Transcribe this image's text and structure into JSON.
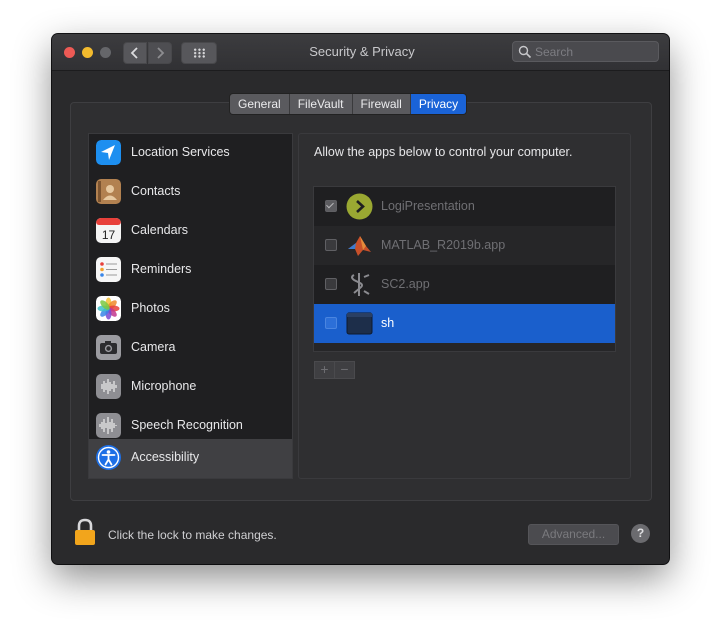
{
  "window": {
    "title": "Security & Privacy",
    "search_placeholder": "Search"
  },
  "icons": {
    "back": "chevron-left-icon",
    "forward": "chevron-right-icon",
    "grid": "grid-icon",
    "search": "search-icon",
    "lock": "lock-icon",
    "help": "question-mark-icon"
  },
  "tabs": [
    {
      "label": "General",
      "active": false
    },
    {
      "label": "FileVault",
      "active": false
    },
    {
      "label": "Firewall",
      "active": false
    },
    {
      "label": "Privacy",
      "active": true
    }
  ],
  "sidebar": {
    "items": [
      {
        "label": "Location Services",
        "icon": "location-arrow-icon"
      },
      {
        "label": "Contacts",
        "icon": "contacts-book-icon"
      },
      {
        "label": "Calendars",
        "icon": "calendar-icon"
      },
      {
        "label": "Reminders",
        "icon": "reminders-list-icon"
      },
      {
        "label": "Photos",
        "icon": "photos-flower-icon"
      },
      {
        "label": "Camera",
        "icon": "camera-icon"
      },
      {
        "label": "Microphone",
        "icon": "microphone-waveform-icon"
      },
      {
        "label": "Speech Recognition",
        "icon": "speech-waveform-icon"
      },
      {
        "label": "Accessibility",
        "icon": "accessibility-icon",
        "selected": true
      }
    ]
  },
  "calendar_icon_day": "17",
  "main": {
    "allow_text": "Allow the apps below to control your computer.",
    "apps": [
      {
        "name": "LogiPresentation",
        "checked": true,
        "icon": "logi-presentation-icon"
      },
      {
        "name": "MATLAB_R2019b.app",
        "checked": false,
        "icon": "matlab-icon"
      },
      {
        "name": "SC2.app",
        "checked": false,
        "icon": "sc2-icon"
      },
      {
        "name": "sh",
        "checked": false,
        "icon": "terminal-exec-icon",
        "selected": true
      },
      {
        "name": "",
        "checked": false,
        "icon": "generic-app-icon"
      }
    ],
    "add_label": "+",
    "remove_label": "−"
  },
  "footer": {
    "lock_text": "Click the lock to make changes.",
    "advanced_label": "Advanced...",
    "help_label": "?"
  },
  "colors": {
    "accent_blue": "#1a63d7",
    "window_bg": "#2a2a2c",
    "list_bg": "#1f1f21",
    "lock_yellow": "#f2a51c"
  }
}
